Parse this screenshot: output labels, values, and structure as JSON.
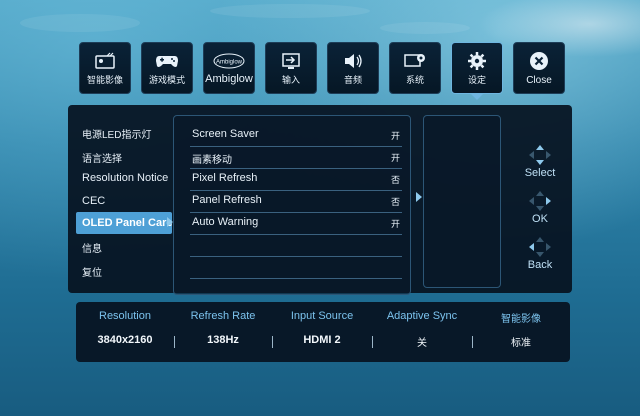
{
  "top_menu": [
    {
      "label": "智能影像",
      "icon": "smart-image-icon"
    },
    {
      "label": "游戏模式",
      "icon": "gamepad-icon"
    },
    {
      "label": "Ambiglow",
      "icon": "ambiglow-logo-icon",
      "icon_text": "Ambiglow"
    },
    {
      "label": "输入",
      "icon": "input-icon"
    },
    {
      "label": "音频",
      "icon": "speaker-icon"
    },
    {
      "label": "系统",
      "icon": "system-gear-icon"
    },
    {
      "label": "设定",
      "icon": "settings-gear-icon",
      "selected": true
    },
    {
      "label": "Close",
      "icon": "close-icon"
    }
  ],
  "categories": [
    {
      "label": "电源LED指示灯"
    },
    {
      "label": "语言选择"
    },
    {
      "label": "Resolution Notice"
    },
    {
      "label": "CEC"
    },
    {
      "label": "OLED Panel Care",
      "active": true
    },
    {
      "label": "信息"
    },
    {
      "label": "复位"
    }
  ],
  "settings": [
    {
      "name": "Screen Saver",
      "value": "开"
    },
    {
      "name": "画素移动",
      "value": "开"
    },
    {
      "name": "Pixel Refresh",
      "value": "否"
    },
    {
      "name": "Panel Refresh",
      "value": "否"
    },
    {
      "name": "Auto Warning",
      "value": "开"
    }
  ],
  "nav_hints": [
    {
      "label": "Select"
    },
    {
      "label": "OK"
    },
    {
      "label": "Back"
    }
  ],
  "status_bar": [
    {
      "header": "Resolution",
      "value": "3840x2160"
    },
    {
      "header": "Refresh Rate",
      "value": "138Hz"
    },
    {
      "header": "Input Source",
      "value": "HDMI 2"
    },
    {
      "header": "Adaptive Sync",
      "value": "关"
    },
    {
      "header": "智能影像",
      "value": "标准"
    }
  ],
  "colors": {
    "accent": "#4ea0d6",
    "header_text": "#7cc3ee",
    "panel_bg": "#061220",
    "water": "#2f84aa"
  }
}
